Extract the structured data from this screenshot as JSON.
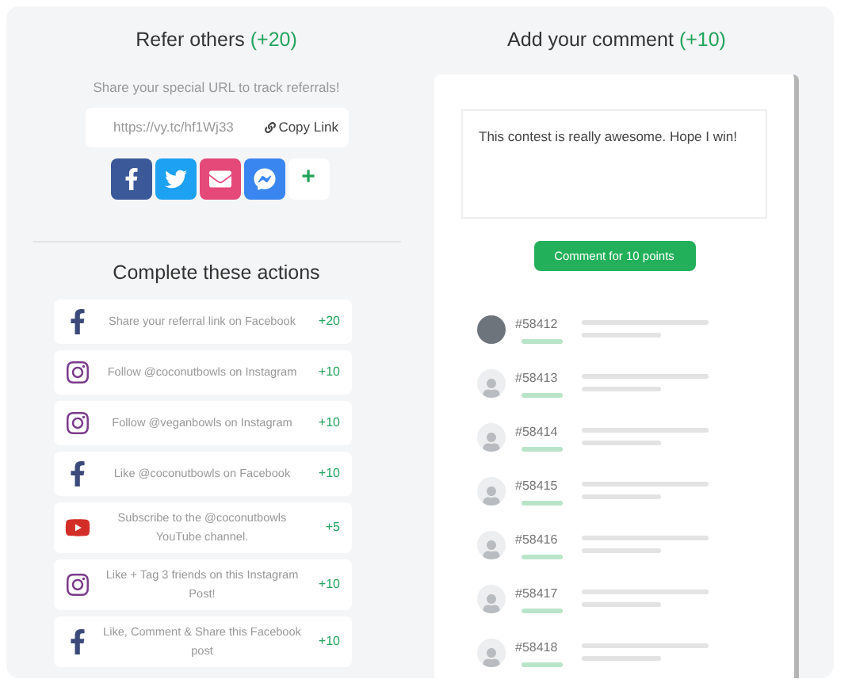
{
  "refer": {
    "title": "Refer others",
    "points": "(+20)",
    "subtitle": "Share your special URL to track referrals!",
    "url": "https://vy.tc/hf1Wj33",
    "copy_label": "Copy Link",
    "share_buttons": [
      {
        "kind": "facebook"
      },
      {
        "kind": "twitter"
      },
      {
        "kind": "email"
      },
      {
        "kind": "messenger"
      },
      {
        "kind": "more",
        "label": "+"
      }
    ]
  },
  "actions": {
    "title": "Complete these actions",
    "items": [
      {
        "kind": "facebook",
        "label": "Share your referral link on Facebook",
        "points": "+20"
      },
      {
        "kind": "instagram",
        "label": "Follow @coconutbowls on Instagram",
        "points": "+10"
      },
      {
        "kind": "instagram",
        "label": "Follow @veganbowls on Instagram",
        "points": "+10"
      },
      {
        "kind": "facebook",
        "label": "Like @coconutbowls on Facebook",
        "points": "+10"
      },
      {
        "kind": "youtube",
        "label": "Subscribe to the @coconutbowls YouTube channel.",
        "points": "+5"
      },
      {
        "kind": "instagram",
        "label": "Like + Tag 3 friends on this Instagram Post!",
        "points": "+10"
      },
      {
        "kind": "facebook",
        "label": "Like, Comment & Share this Facebook post",
        "points": "+10"
      }
    ]
  },
  "comment": {
    "title": "Add your comment",
    "points": "(+10)",
    "value": "This contest is really awesome. Hope I win!",
    "button": "Comment for 10 points",
    "comments": [
      {
        "id": "#58412",
        "photo": true
      },
      {
        "id": "#58413",
        "photo": false
      },
      {
        "id": "#58414",
        "photo": false
      },
      {
        "id": "#58415",
        "photo": false
      },
      {
        "id": "#58416",
        "photo": false
      },
      {
        "id": "#58417",
        "photo": false
      },
      {
        "id": "#58418",
        "photo": false
      }
    ]
  }
}
